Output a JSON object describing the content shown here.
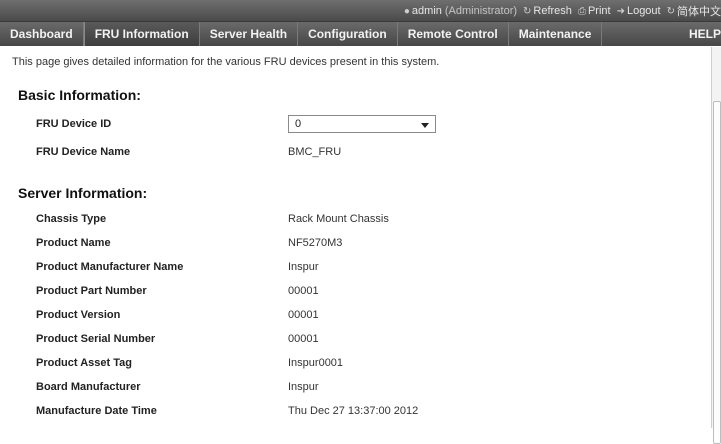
{
  "topbar": {
    "user": "admin",
    "role": "(Administrator)",
    "refresh_label": "Refresh",
    "print_label": "Print",
    "logout_label": "Logout",
    "language_label": "简体中文"
  },
  "nav": {
    "tabs": [
      {
        "label": "Dashboard"
      },
      {
        "label": "FRU Information"
      },
      {
        "label": "Server Health"
      },
      {
        "label": "Configuration"
      },
      {
        "label": "Remote Control"
      },
      {
        "label": "Maintenance"
      }
    ],
    "help_label": "HELP",
    "active_tab": "FRU Information"
  },
  "page": {
    "intro": "This page gives detailed information for the various FRU devices present in this system."
  },
  "basic": {
    "title": "Basic Information:",
    "fru_device_id_label": "FRU Device ID",
    "fru_device_id_value": "0",
    "fru_device_name_label": "FRU Device Name",
    "fru_device_name_value": "BMC_FRU"
  },
  "server": {
    "title": "Server Information:",
    "rows": [
      {
        "label": "Chassis Type",
        "value": "Rack Mount Chassis"
      },
      {
        "label": "Product Name",
        "value": "NF5270M3"
      },
      {
        "label": "Product Manufacturer Name",
        "value": "Inspur"
      },
      {
        "label": "Product Part Number",
        "value": "00001"
      },
      {
        "label": "Product Version",
        "value": "00001"
      },
      {
        "label": "Product Serial Number",
        "value": "00001"
      },
      {
        "label": "Product Asset Tag",
        "value": "Inspur0001"
      },
      {
        "label": "Board Manufacturer",
        "value": "Inspur"
      },
      {
        "label": "Manufacture Date Time",
        "value": "Thu Dec 27 13:37:00 2012"
      }
    ]
  },
  "colors": {
    "nav_bg": "#4a4a4a",
    "nav_text": "#f2f2f2"
  }
}
